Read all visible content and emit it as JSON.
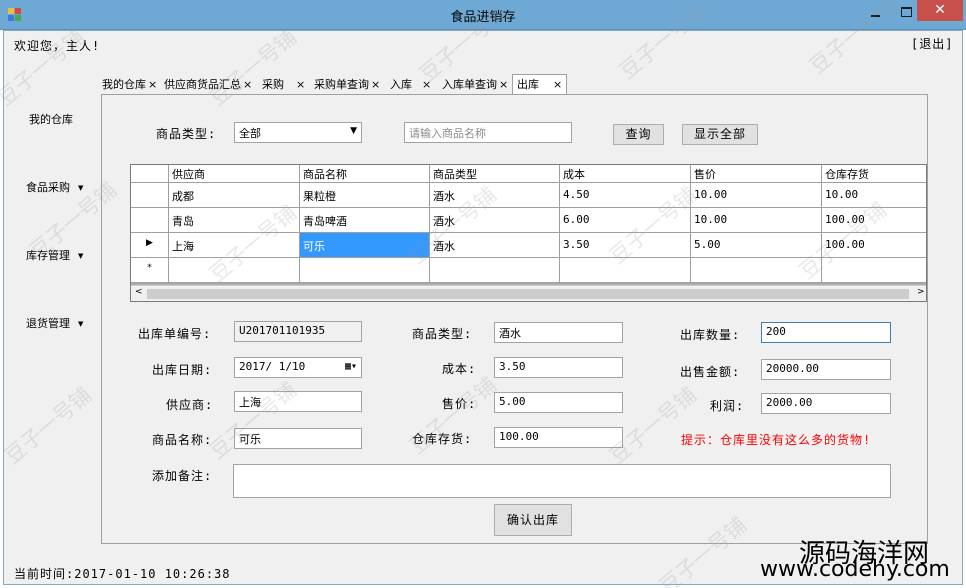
{
  "window": {
    "title": "食品进销存"
  },
  "header": {
    "welcome": "欢迎您，主人!",
    "logout": "[退出]"
  },
  "nav": {
    "items": [
      {
        "label": "我的仓库",
        "has_dropdown": false
      },
      {
        "label": "食品采购",
        "has_dropdown": true
      },
      {
        "label": "库存管理",
        "has_dropdown": true
      },
      {
        "label": "退货管理",
        "has_dropdown": true
      }
    ]
  },
  "tabs": [
    {
      "label": "我的仓库",
      "close": "×"
    },
    {
      "label": "供应商货品汇总",
      "close": "×"
    },
    {
      "label": "采购",
      "close": "×"
    },
    {
      "label": "采购单查询",
      "close": "×"
    },
    {
      "label": "入库",
      "close": "×"
    },
    {
      "label": "入库单查询",
      "close": "×"
    },
    {
      "label": "出库",
      "close": "×",
      "active": true
    }
  ],
  "search": {
    "type_label": "商品类型:",
    "type_value": "全部",
    "name_placeholder": "请输入商品名称",
    "query_button": "查询",
    "show_all_button": "显示全部"
  },
  "grid": {
    "columns": [
      "供应商",
      "商品名称",
      "商品类型",
      "成本",
      "售价",
      "仓库存货"
    ],
    "rows": [
      {
        "marker": "",
        "cells": [
          "成都",
          "果粒橙",
          "酒水",
          "4.50",
          "10.00",
          "10.00"
        ]
      },
      {
        "marker": "",
        "cells": [
          "青岛",
          "青岛啤酒",
          "酒水",
          "6.00",
          "10.00",
          "100.00"
        ]
      },
      {
        "marker": "▶",
        "cells": [
          "上海",
          "可乐",
          "酒水",
          "3.50",
          "5.00",
          "100.00"
        ],
        "selected_col": 1
      }
    ],
    "new_row_marker": "*"
  },
  "form": {
    "order_no_label": "出库单编号:",
    "order_no_value": "U201701101935",
    "date_label": "出库日期:",
    "date_value": "2017/ 1/10",
    "supplier_label": "供应商:",
    "supplier_value": "上海",
    "product_label": "商品名称:",
    "product_value": "可乐",
    "type_label": "商品类型:",
    "type_value": "酒水",
    "cost_label": "成本:",
    "cost_value": "3.50",
    "price_label": "售价:",
    "price_value": "5.00",
    "stock_label": "仓库存货:",
    "stock_value": "100.00",
    "qty_label": "出库数量:",
    "qty_value": "200",
    "amount_label": "出售金额:",
    "amount_value": "20000.00",
    "profit_label": "利润:",
    "profit_value": "2000.00",
    "note_label": "添加备注:",
    "note_value": "",
    "hint": "提示：仓库里没有这么多的货物!",
    "confirm_button": "确认出库"
  },
  "status": {
    "time": "当前时间:2017-01-10 10:26:38"
  },
  "watermark": {
    "text": "豆子一号铺",
    "brand_cn": "源码海洋网",
    "brand_url": "www.codehy.com"
  },
  "colors": {
    "titlebar": "#6ea9d6",
    "close": "#c7504b",
    "selection": "#3399ff",
    "hint": "#ff0000"
  }
}
